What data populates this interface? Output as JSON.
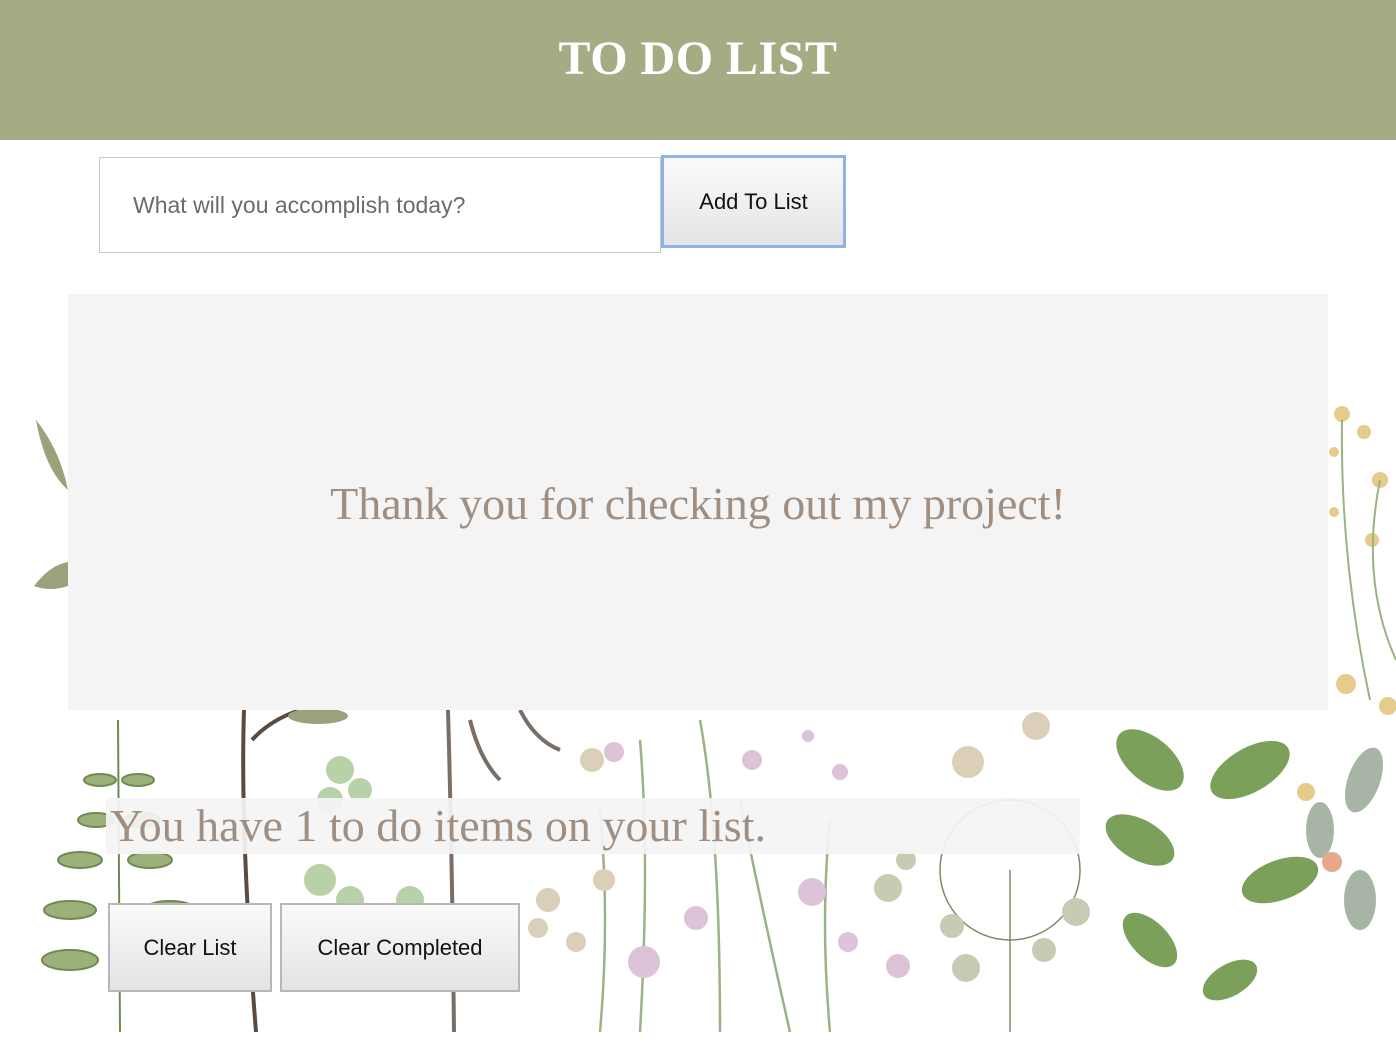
{
  "header": {
    "title": "TO DO LIST"
  },
  "form": {
    "input_placeholder": "What will you accomplish today?",
    "input_value": "",
    "add_button_label": "Add To List"
  },
  "list": {
    "message": "Thank you for checking out my project!"
  },
  "summary": {
    "count_text": "You have 1 to do items on your list."
  },
  "actions": {
    "clear_list_label": "Clear List",
    "clear_completed_label": "Clear Completed"
  },
  "colors": {
    "header_bg": "#a4ac84",
    "message_text": "#a08e81",
    "panel_bg": "#f4f4f4",
    "focus_ring": "#8db4e8"
  }
}
